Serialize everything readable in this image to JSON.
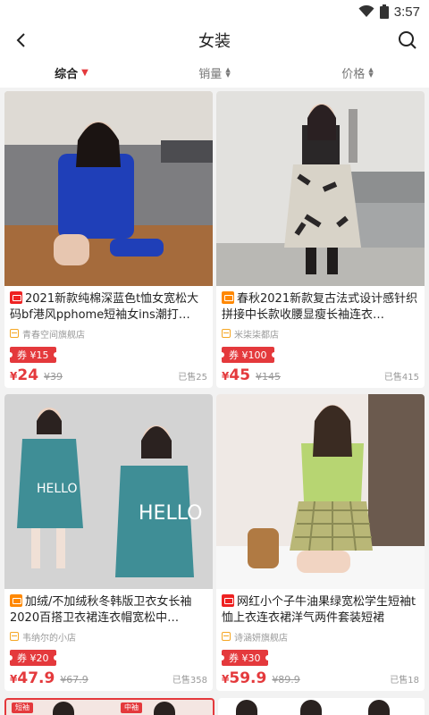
{
  "status": {
    "time": "3:57"
  },
  "header": {
    "title": "女装"
  },
  "sort": [
    {
      "label": "综合",
      "active": true
    },
    {
      "label": "销量",
      "active": false
    },
    {
      "label": "价格",
      "active": false
    }
  ],
  "colors": {
    "accent": "#e4393c",
    "tmall": "#ee2222",
    "taobao": "#ff8800"
  },
  "products": [
    {
      "platform": "tmall",
      "title": "2021新款纯棉深蓝色t恤女宽松大码bf港风pphome短袖女ins潮打…",
      "shop": "青春空间旗舰店",
      "coupon": "券 ¥15",
      "yen": "¥",
      "price": "24",
      "old_price": "¥39",
      "sold": "已售25"
    },
    {
      "platform": "taobao",
      "title": "春秋2021新款复古法式设计感针织拼接中长款收腰显瘦长袖连衣…",
      "shop": "米柒柒都店",
      "coupon": "券 ¥100",
      "yen": "¥",
      "price": "45",
      "old_price": "¥145",
      "sold": "已售415"
    },
    {
      "platform": "taobao",
      "title": "加绒/不加绒秋冬韩版卫衣女长袖2020百搭卫衣裙连衣帽宽松中…",
      "shop": "韦纳尔的小店",
      "coupon": "券 ¥20",
      "yen": "¥",
      "price": "47.9",
      "old_price": "¥67.9",
      "sold": "已售358"
    },
    {
      "platform": "tmall",
      "title": "网红小个子牛油果绿宽松学生短袖t恤上衣连衣裙洋气两件套装短裙",
      "shop": "诗涵妍旗舰店",
      "coupon": "券 ¥30",
      "yen": "¥",
      "price": "59.9",
      "old_price": "¥89.9",
      "sold": "已售18"
    }
  ],
  "partial": {
    "badge_left": "短袖",
    "badge_mid": "中袖"
  }
}
